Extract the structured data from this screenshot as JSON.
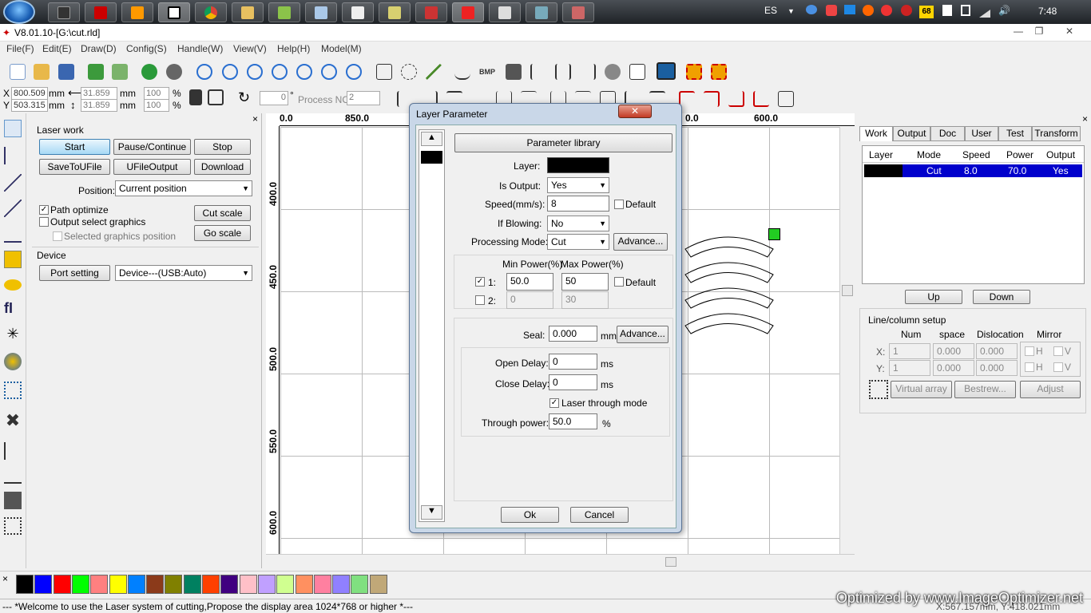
{
  "taskbar": {
    "lang": "ES",
    "badge": "68",
    "clock": "7:48"
  },
  "window": {
    "title": "V8.01.10-[G:\\cut.rld]",
    "min": "—",
    "max": "❐",
    "close": "✕"
  },
  "menu": [
    "File(F)",
    "Edit(E)",
    "Draw(D)",
    "Config(S)",
    "Handle(W)",
    "View(V)",
    "Help(H)",
    "Model(M)"
  ],
  "coords": {
    "x_label": "X",
    "y_label": "Y",
    "x": "800.509",
    "y": "503.315",
    "unit": "mm",
    "w": "31.859",
    "h": "31.859",
    "w_pct": "100",
    "h_pct": "100",
    "pct": "%",
    "rot": "0",
    "deg": "°",
    "process_no_label": "Process NO:",
    "process_no": "2"
  },
  "laser": {
    "section": "Laser work",
    "start": "Start",
    "pause": "Pause/Continue",
    "stop": "Stop",
    "save_ufile": "SaveToUFile",
    "ufile_output": "UFileOutput",
    "download": "Download",
    "position_label": "Position:",
    "position": "Current position",
    "path_optimize": "Path optimize",
    "output_select": "Output select graphics",
    "selected_pos": "Selected graphics position",
    "cut_scale": "Cut scale",
    "go_scale": "Go scale",
    "device_section": "Device",
    "port_setting": "Port setting",
    "device": "Device---(USB:Auto)"
  },
  "ruler": {
    "top": [
      "0.0",
      "850.0",
      "0.0",
      "600.0"
    ],
    "left": [
      "400.0",
      "450.0",
      "500.0",
      "550.0",
      "600.0"
    ]
  },
  "right": {
    "tabs": [
      "Work",
      "Output",
      "Doc",
      "User",
      "Test",
      "Transform"
    ],
    "cols": [
      "Layer",
      "Mode",
      "Speed",
      "Power",
      "Output"
    ],
    "row": {
      "mode": "Cut",
      "speed": "8.0",
      "power": "70.0",
      "output": "Yes"
    },
    "up": "Up",
    "down": "Down",
    "linecol": "Line/column setup",
    "num": "Num",
    "space": "space",
    "disloc": "Dislocation",
    "mirror": "Mirror",
    "xl": "X:",
    "yl": "Y:",
    "n1": "1",
    "s1": "0.000",
    "d1": "0.000",
    "h": "H",
    "v": "V",
    "virtual": "Virtual array",
    "bestrew": "Bestrew...",
    "adjust": "Adjust"
  },
  "dialog": {
    "title": "Layer Parameter",
    "close": "✕",
    "param_lib": "Parameter library",
    "layer_label": "Layer:",
    "is_output_label": "Is Output:",
    "is_output": "Yes",
    "speed_label": "Speed(mm/s):",
    "speed": "8",
    "default": "Default",
    "blowing_label": "If Blowing:",
    "blowing": "No",
    "mode_label": "Processing Mode:",
    "mode": "Cut",
    "advance": "Advance...",
    "min_power": "Min Power(%)",
    "max_power": "Max Power(%)",
    "p1": "1:",
    "p1_min": "50.0",
    "p1_max": "50",
    "p2": "2:",
    "p2_min": "0",
    "p2_max": "30",
    "seal_label": "Seal:",
    "seal": "0.000",
    "mm": "mm",
    "open_delay_label": "Open Delay:",
    "open_delay": "0",
    "ms": "ms",
    "close_delay_label": "Close Delay:",
    "close_delay": "0",
    "through_mode": "Laser through mode",
    "through_power_label": "Through power:",
    "through_power": "50.0",
    "pct": "%",
    "ok": "Ok",
    "cancel": "Cancel"
  },
  "palette": [
    "#000000",
    "#0000ff",
    "#ff0000",
    "#00ff00",
    "#ff8080",
    "#ffff00",
    "#0080ff",
    "#8b3a1a",
    "#808000",
    "#008060",
    "#ff4000",
    "#400080",
    "#ffc0c8",
    "#c0a0ff",
    "#d0ff90",
    "#ff9060",
    "#ff80a0",
    "#9080ff",
    "#80e080",
    "#c0a878"
  ],
  "status": "--- *Welcome to use the Laser system of cutting,Propose the display area 1024*768 or higher *---",
  "status_coords": "X:567.157mm, Y:418.021mm",
  "watermark": "Optimized by www.ImageOptimizer.net"
}
